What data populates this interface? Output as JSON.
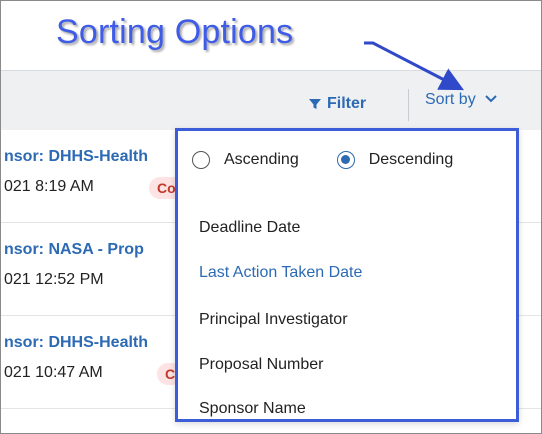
{
  "annotation": {
    "title": "Sorting Options",
    "color": "#3e5ce6"
  },
  "toolbar": {
    "filter_label": "Filter",
    "filter_icon": "filter-icon",
    "sort_label": "Sort by",
    "sort_icon": "chevron-down-icon"
  },
  "list": {
    "items": [
      {
        "sponsor": "nsor: DHHS-Health",
        "date": "021 8:19 AM",
        "badge": "Co"
      },
      {
        "sponsor": "nsor: NASA - Prop",
        "date": "021 12:52 PM",
        "badge": ""
      },
      {
        "sponsor": "nsor: DHHS-Health",
        "date": "021 10:47 AM",
        "badge": "C"
      }
    ]
  },
  "sort_panel": {
    "order_options": [
      {
        "label": "Ascending",
        "selected": false
      },
      {
        "label": "Descending",
        "selected": true
      }
    ],
    "fields": [
      {
        "label": "Deadline Date",
        "active": false
      },
      {
        "label": "Last Action Taken Date",
        "active": true
      },
      {
        "label": "Principal Investigator",
        "active": false
      },
      {
        "label": "Proposal Number",
        "active": false
      },
      {
        "label": "Sponsor Name",
        "active": false
      }
    ]
  },
  "colors": {
    "link_blue": "#2c6ab4",
    "panel_border": "#3c5cd8",
    "badge_bg": "#fde3e3",
    "badge_text": "#c0392b"
  }
}
